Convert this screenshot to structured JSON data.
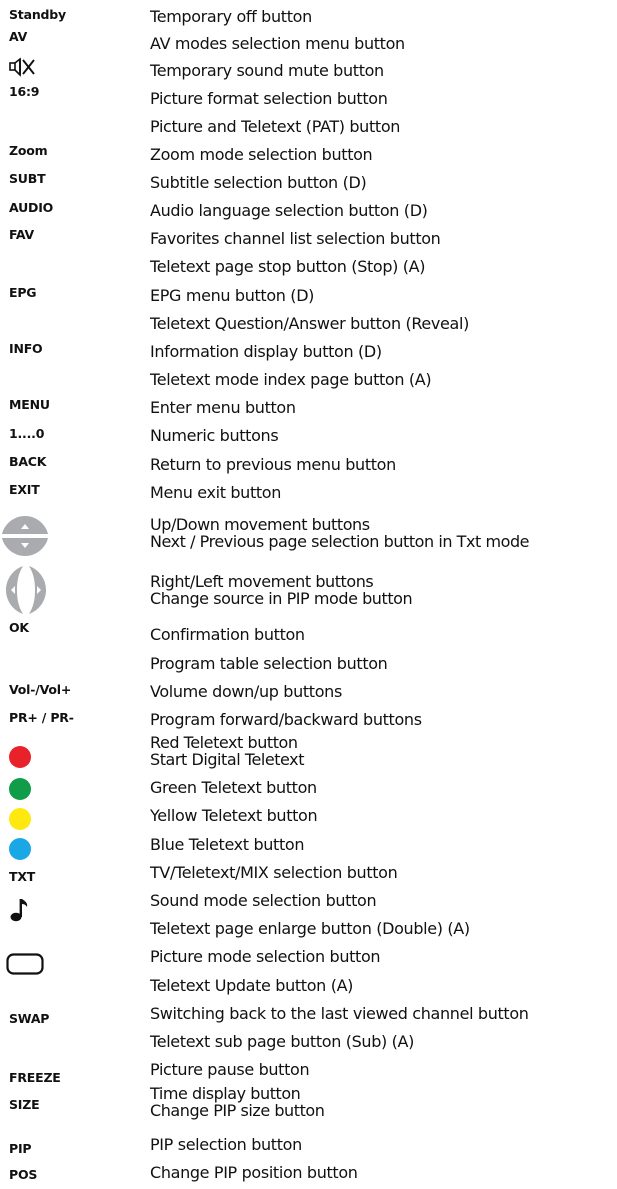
{
  "rows": [
    {
      "key": "Standby",
      "desc": "Temporary off button"
    },
    {
      "key": "AV",
      "desc": "AV modes selection menu button"
    },
    {
      "key": "",
      "desc": "Temporary sound mute button"
    },
    {
      "key": "16:9",
      "desc": "Picture format selection button"
    },
    {
      "key": "",
      "desc": "Picture and Teletext (PAT) button"
    },
    {
      "key": "Zoom",
      "desc": "Zoom mode selection button"
    },
    {
      "key": "SUBT",
      "desc": "Subtitle selection button (D)"
    },
    {
      "key": "AUDIO",
      "desc": "Audio language selection button (D)"
    },
    {
      "key": "FAV",
      "desc": "Favorites channel list selection button"
    },
    {
      "key": "",
      "desc": "Teletext page stop button (Stop) (A)"
    },
    {
      "key": "EPG",
      "desc": "EPG menu button (D)"
    },
    {
      "key": "",
      "desc": "Teletext Question/Answer button (Reveal)"
    },
    {
      "key": "INFO",
      "desc": "Information display button (D)"
    },
    {
      "key": "",
      "desc": "Teletext mode index page button (A)"
    },
    {
      "key": "MENU",
      "desc": "Enter menu button"
    },
    {
      "key": "1....0",
      "desc": "Numeric buttons"
    },
    {
      "key": "BACK",
      "desc": "Return to previous menu button"
    },
    {
      "key": "EXIT",
      "desc": "Menu exit button"
    },
    {
      "key": "",
      "desc": "Up/Down movement buttons",
      "desc2": "Next / Previous page selection button in Txt mode"
    },
    {
      "key": "",
      "desc": "Right/Left movement buttons",
      "desc2": "Change source in PIP mode button"
    },
    {
      "key": "OK",
      "desc": "Confirmation button"
    },
    {
      "key": "",
      "desc": "Program table selection button"
    },
    {
      "key": "Vol-/Vol+",
      "desc": "Volume down/up buttons"
    },
    {
      "key": "PR+ / PR-",
      "desc": "Program forward/backward buttons"
    },
    {
      "key": "",
      "desc": "Red Teletext button",
      "desc2": "Start Digital Teletext"
    },
    {
      "key": "",
      "desc": "Green Teletext button"
    },
    {
      "key": "",
      "desc": "Yellow Teletext button"
    },
    {
      "key": "",
      "desc": "Blue Teletext button"
    },
    {
      "key": "TXT",
      "desc": "TV/Teletext/MIX selection button"
    },
    {
      "key": "",
      "desc": "Sound mode selection button"
    },
    {
      "key": "",
      "desc": "Teletext page enlarge button (Double) (A)"
    },
    {
      "key": "",
      "desc": "Picture mode selection button"
    },
    {
      "key": "",
      "desc": "Teletext Update button (A)"
    },
    {
      "key": "SWAP",
      "desc": "Switching back to the last viewed channel button"
    },
    {
      "key": "",
      "desc": "Teletext sub page button (Sub) (A)"
    },
    {
      "key": "FREEZE",
      "desc": "Picture pause button"
    },
    {
      "key": "SIZE",
      "desc": "Time display button",
      "desc2": "Change PIP size button"
    },
    {
      "key": "PIP",
      "desc": "PIP selection button"
    },
    {
      "key": "POS",
      "desc": "Change PIP position button"
    }
  ],
  "icons": {
    "mute": "mute-speaker-icon",
    "updown": "up-down-arrows-icon",
    "leftright": "left-right-arrows-icon",
    "note": "music-note-icon",
    "rect": "rounded-rectangle-icon"
  },
  "colors": {
    "red": "#e8212b",
    "green": "#109c48",
    "yellow": "#fde80f",
    "blue": "#1aa7e6",
    "arrow_gray": "#a9abae"
  }
}
